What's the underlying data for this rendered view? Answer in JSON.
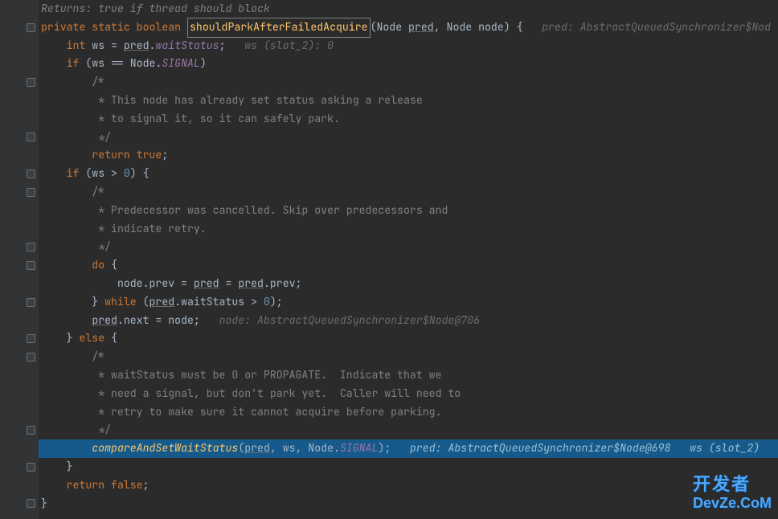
{
  "doc": {
    "returns_label": "Returns:",
    "returns_value": " true if thread should block"
  },
  "lines": {
    "l1_pre": "private static boolean ",
    "l1_method": "shouldParkAfterFailedAcquire",
    "l1_post_a": "(Node ",
    "l1_pred": "pred",
    "l1_post_b": ", Node node) {",
    "l1_hint": "   pred: AbstractQueuedSynchronizer$Nod",
    "l2_a": "    int ws = ",
    "l2_pred": "pred",
    "l2_b": ".",
    "l2_wait": "waitStatus",
    "l2_c": ";",
    "l2_hint": "   ws (slot_2): 0",
    "l3_a": "    if (ws == Node.",
    "l3_signal": "SIGNAL",
    "l3_b": ")",
    "l4": "        /*",
    "l5": "         * This node has already set status asking a release",
    "l6": "         * to signal it, so it can safely park.",
    "l7": "         */",
    "l8_a": "        return ",
    "l8_true": "true",
    "l8_b": ";",
    "l9_a": "    if (ws > ",
    "l9_zero": "0",
    "l9_b": ") {",
    "l10": "        /*",
    "l11": "         * Predecessor was cancelled. Skip over predecessors and",
    "l12": "         * indicate retry.",
    "l13": "         */",
    "l14_a": "        do",
    "l14_b": " {",
    "l15_a": "            node.prev = ",
    "l15_pred1": "pred",
    "l15_b": " = ",
    "l15_pred2": "pred",
    "l15_c": ".prev;",
    "l16_a": "        } ",
    "l16_while": "while",
    "l16_b": " (",
    "l16_pred": "pred",
    "l16_c": ".waitStatus > ",
    "l16_zero": "0",
    "l16_d": ");",
    "l17_a": "        ",
    "l17_pred": "pred",
    "l17_b": ".next = node;",
    "l17_hint": "   node: AbstractQueuedSynchronizer$Node@706",
    "l18_a": "    } ",
    "l18_else": "else",
    "l18_b": " {",
    "l19": "        /*",
    "l20": "         * waitStatus must be 0 or PROPAGATE.  Indicate that we",
    "l21": "         * need a signal, but don't park yet.  Caller will need to",
    "l22": "         * retry to make sure it cannot acquire before parking.",
    "l23": "         */",
    "l24_a": "        ",
    "l24_fn": "compareAndSetWaitStatus",
    "l24_b": "(",
    "l24_pred": "pred",
    "l24_c": ", ws, Node.",
    "l24_signal": "SIGNAL",
    "l24_d": ");",
    "l24_hint": "   pred: AbstractQueuedSynchronizer$Node@698   ws (slot_2)",
    "l25": "    }",
    "l26_a": "    return ",
    "l26_false": "false",
    "l26_b": ";",
    "l27": "}"
  },
  "watermark": {
    "cn": "开发者",
    "en": "DevZe.CoM"
  }
}
